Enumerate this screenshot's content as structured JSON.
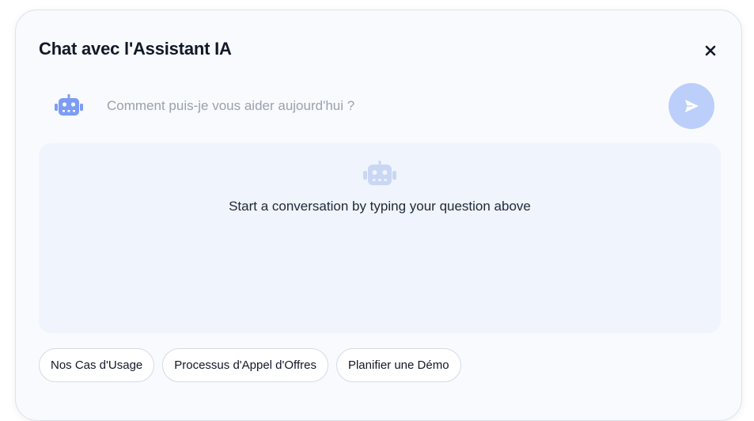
{
  "modal": {
    "title": "Chat avec l'Assistant IA",
    "close_icon": "close-icon"
  },
  "input": {
    "placeholder": "Comment puis-je vous aider aujourd'hui ?",
    "value": "",
    "bot_icon": "robot-icon",
    "send_icon": "send-icon"
  },
  "conversation": {
    "empty_icon": "robot-icon",
    "empty_message": "Start a conversation by typing your question above"
  },
  "quick_actions": [
    {
      "label": "Nos Cas d'Usage"
    },
    {
      "label": "Processus d'Appel d'Offres"
    },
    {
      "label": "Planifier une Démo"
    }
  ],
  "colors": {
    "accent": "#7c9cf5",
    "send_button": "#bccffa",
    "conversation_bg": "#eff4fd"
  }
}
